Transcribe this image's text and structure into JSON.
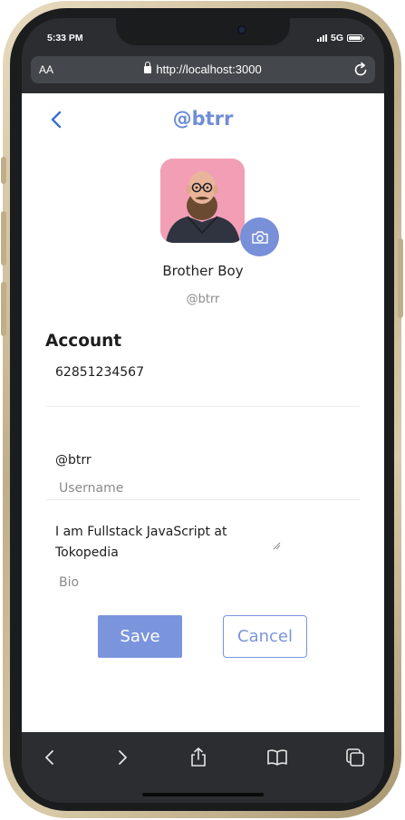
{
  "status_bar": {
    "time": "5:33 PM",
    "network": "5G",
    "signal_icon": "signal-bars-icon",
    "battery_icon": "battery-icon"
  },
  "browser": {
    "text_size_label": "AA",
    "url": "http://localhost:3000",
    "lock_icon": "lock-icon",
    "reload_icon": "reload-icon"
  },
  "header": {
    "back_icon": "chevron-left-icon",
    "title": "@btrr"
  },
  "profile": {
    "avatar_icon": "avatar-photo",
    "camera_icon": "camera-icon",
    "name": "Brother Boy",
    "handle": "@btrr"
  },
  "account": {
    "section_title": "Account",
    "phone_value": "62851234567",
    "username_value": "@btrr",
    "username_label": "Username",
    "bio_value": "I am Fullstack JavaScript at Tokopedia",
    "bio_label": "Bio"
  },
  "actions": {
    "save_label": "Save",
    "cancel_label": "Cancel"
  },
  "toolbar": {
    "back_icon": "chevron-left-icon",
    "forward_icon": "chevron-right-icon",
    "share_icon": "share-icon",
    "bookmarks_icon": "book-icon",
    "tabs_icon": "tabs-icon"
  },
  "colors": {
    "accent": "#7b95dd",
    "title": "#6f8ed6",
    "frame_gold": "#d9caa8",
    "browser_chrome": "#2b2d30",
    "avatar_bg": "#f29fb6"
  }
}
